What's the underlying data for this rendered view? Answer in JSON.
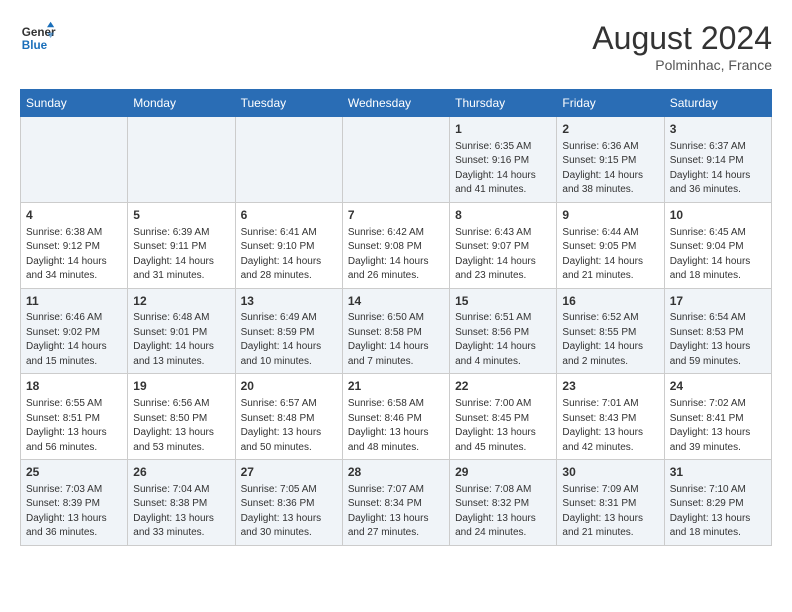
{
  "header": {
    "logo_line1": "General",
    "logo_line2": "Blue",
    "month_year": "August 2024",
    "location": "Polminhac, France"
  },
  "days_of_week": [
    "Sunday",
    "Monday",
    "Tuesday",
    "Wednesday",
    "Thursday",
    "Friday",
    "Saturday"
  ],
  "weeks": [
    [
      {
        "day": "",
        "info": ""
      },
      {
        "day": "",
        "info": ""
      },
      {
        "day": "",
        "info": ""
      },
      {
        "day": "",
        "info": ""
      },
      {
        "day": "1",
        "info": "Sunrise: 6:35 AM\nSunset: 9:16 PM\nDaylight: 14 hours\nand 41 minutes."
      },
      {
        "day": "2",
        "info": "Sunrise: 6:36 AM\nSunset: 9:15 PM\nDaylight: 14 hours\nand 38 minutes."
      },
      {
        "day": "3",
        "info": "Sunrise: 6:37 AM\nSunset: 9:14 PM\nDaylight: 14 hours\nand 36 minutes."
      }
    ],
    [
      {
        "day": "4",
        "info": "Sunrise: 6:38 AM\nSunset: 9:12 PM\nDaylight: 14 hours\nand 34 minutes."
      },
      {
        "day": "5",
        "info": "Sunrise: 6:39 AM\nSunset: 9:11 PM\nDaylight: 14 hours\nand 31 minutes."
      },
      {
        "day": "6",
        "info": "Sunrise: 6:41 AM\nSunset: 9:10 PM\nDaylight: 14 hours\nand 28 minutes."
      },
      {
        "day": "7",
        "info": "Sunrise: 6:42 AM\nSunset: 9:08 PM\nDaylight: 14 hours\nand 26 minutes."
      },
      {
        "day": "8",
        "info": "Sunrise: 6:43 AM\nSunset: 9:07 PM\nDaylight: 14 hours\nand 23 minutes."
      },
      {
        "day": "9",
        "info": "Sunrise: 6:44 AM\nSunset: 9:05 PM\nDaylight: 14 hours\nand 21 minutes."
      },
      {
        "day": "10",
        "info": "Sunrise: 6:45 AM\nSunset: 9:04 PM\nDaylight: 14 hours\nand 18 minutes."
      }
    ],
    [
      {
        "day": "11",
        "info": "Sunrise: 6:46 AM\nSunset: 9:02 PM\nDaylight: 14 hours\nand 15 minutes."
      },
      {
        "day": "12",
        "info": "Sunrise: 6:48 AM\nSunset: 9:01 PM\nDaylight: 14 hours\nand 13 minutes."
      },
      {
        "day": "13",
        "info": "Sunrise: 6:49 AM\nSunset: 8:59 PM\nDaylight: 14 hours\nand 10 minutes."
      },
      {
        "day": "14",
        "info": "Sunrise: 6:50 AM\nSunset: 8:58 PM\nDaylight: 14 hours\nand 7 minutes."
      },
      {
        "day": "15",
        "info": "Sunrise: 6:51 AM\nSunset: 8:56 PM\nDaylight: 14 hours\nand 4 minutes."
      },
      {
        "day": "16",
        "info": "Sunrise: 6:52 AM\nSunset: 8:55 PM\nDaylight: 14 hours\nand 2 minutes."
      },
      {
        "day": "17",
        "info": "Sunrise: 6:54 AM\nSunset: 8:53 PM\nDaylight: 13 hours\nand 59 minutes."
      }
    ],
    [
      {
        "day": "18",
        "info": "Sunrise: 6:55 AM\nSunset: 8:51 PM\nDaylight: 13 hours\nand 56 minutes."
      },
      {
        "day": "19",
        "info": "Sunrise: 6:56 AM\nSunset: 8:50 PM\nDaylight: 13 hours\nand 53 minutes."
      },
      {
        "day": "20",
        "info": "Sunrise: 6:57 AM\nSunset: 8:48 PM\nDaylight: 13 hours\nand 50 minutes."
      },
      {
        "day": "21",
        "info": "Sunrise: 6:58 AM\nSunset: 8:46 PM\nDaylight: 13 hours\nand 48 minutes."
      },
      {
        "day": "22",
        "info": "Sunrise: 7:00 AM\nSunset: 8:45 PM\nDaylight: 13 hours\nand 45 minutes."
      },
      {
        "day": "23",
        "info": "Sunrise: 7:01 AM\nSunset: 8:43 PM\nDaylight: 13 hours\nand 42 minutes."
      },
      {
        "day": "24",
        "info": "Sunrise: 7:02 AM\nSunset: 8:41 PM\nDaylight: 13 hours\nand 39 minutes."
      }
    ],
    [
      {
        "day": "25",
        "info": "Sunrise: 7:03 AM\nSunset: 8:39 PM\nDaylight: 13 hours\nand 36 minutes."
      },
      {
        "day": "26",
        "info": "Sunrise: 7:04 AM\nSunset: 8:38 PM\nDaylight: 13 hours\nand 33 minutes."
      },
      {
        "day": "27",
        "info": "Sunrise: 7:05 AM\nSunset: 8:36 PM\nDaylight: 13 hours\nand 30 minutes."
      },
      {
        "day": "28",
        "info": "Sunrise: 7:07 AM\nSunset: 8:34 PM\nDaylight: 13 hours\nand 27 minutes."
      },
      {
        "day": "29",
        "info": "Sunrise: 7:08 AM\nSunset: 8:32 PM\nDaylight: 13 hours\nand 24 minutes."
      },
      {
        "day": "30",
        "info": "Sunrise: 7:09 AM\nSunset: 8:31 PM\nDaylight: 13 hours\nand 21 minutes."
      },
      {
        "day": "31",
        "info": "Sunrise: 7:10 AM\nSunset: 8:29 PM\nDaylight: 13 hours\nand 18 minutes."
      }
    ]
  ]
}
